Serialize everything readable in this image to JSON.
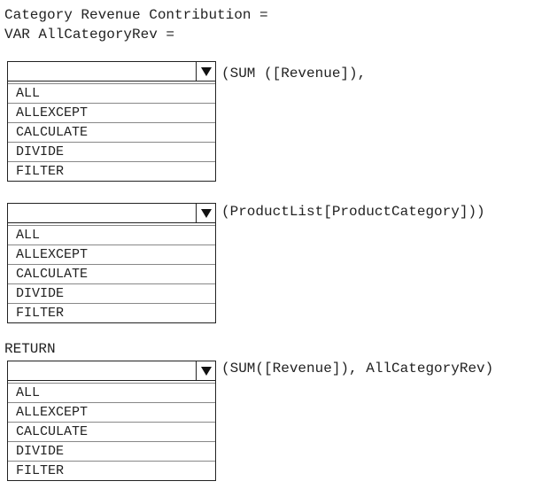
{
  "code": {
    "line1": "Category Revenue Contribution =",
    "line2": "VAR AllCategoryRev =",
    "return_kw": "RETURN"
  },
  "dropdowns": [
    {
      "selected": "",
      "options": [
        "ALL",
        "ALLEXCEPT",
        "CALCULATE",
        "DIVIDE",
        "FILTER"
      ],
      "suffix": "(SUM ([Revenue]),"
    },
    {
      "selected": "",
      "options": [
        "ALL",
        "ALLEXCEPT",
        "CALCULATE",
        "DIVIDE",
        "FILTER"
      ],
      "suffix": "(ProductList[ProductCategory]))"
    },
    {
      "selected": "",
      "options": [
        "ALL",
        "ALLEXCEPT",
        "CALCULATE",
        "DIVIDE",
        "FILTER"
      ],
      "suffix": "(SUM([Revenue]), AllCategoryRev)"
    }
  ],
  "icons": {
    "dropdown_arrow": "triangle-down-icon"
  }
}
